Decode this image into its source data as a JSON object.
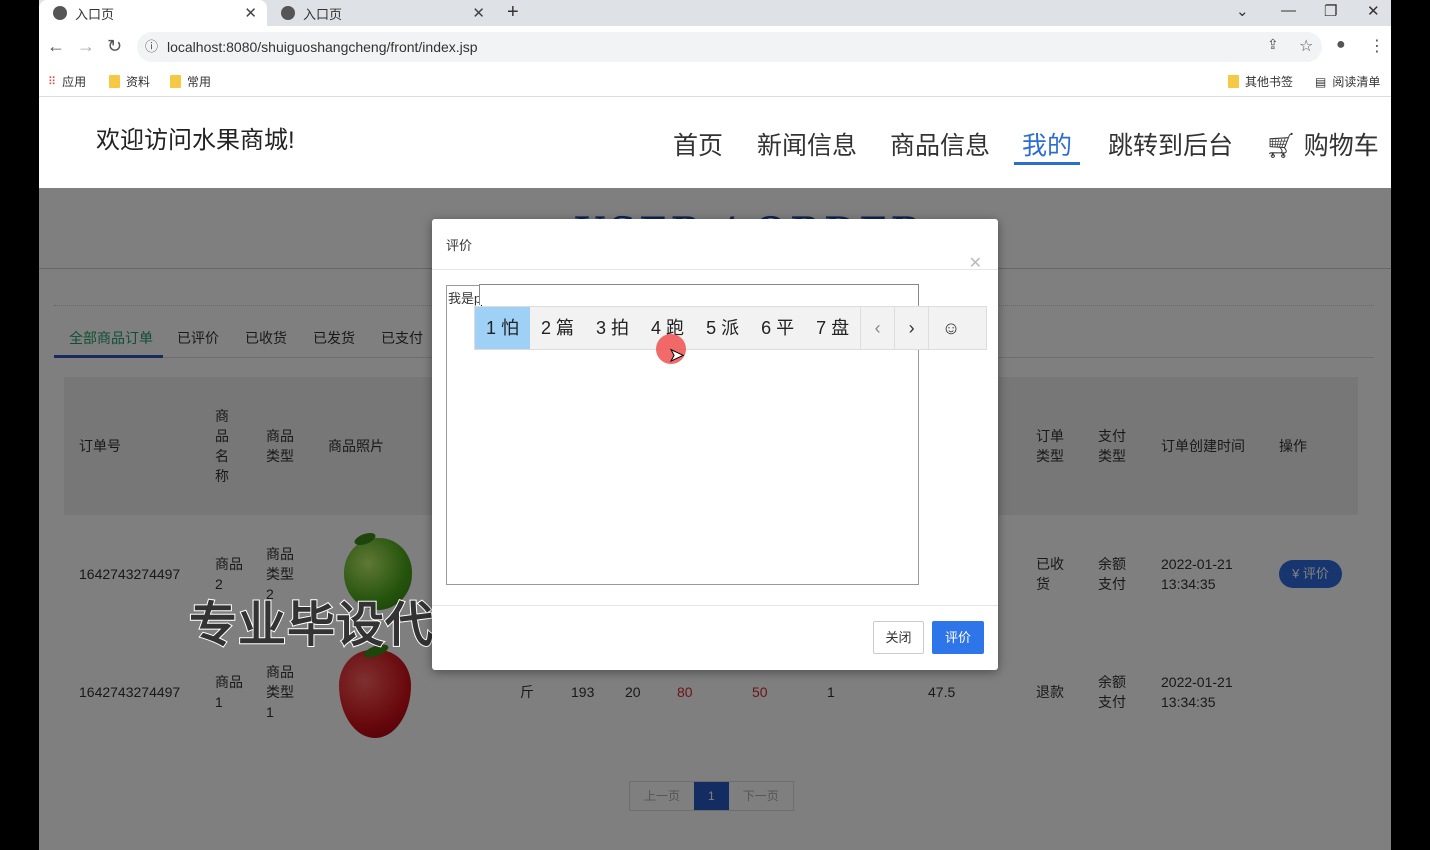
{
  "browser": {
    "tabs": [
      {
        "title": "入口页"
      },
      {
        "title": "入口页"
      }
    ],
    "url": "localhost:8080/shuiguoshangcheng/front/index.jsp",
    "bookmarks": [
      "应用",
      "资料",
      "常用"
    ],
    "bookmarks_right": [
      "其他书签",
      "阅读清单"
    ]
  },
  "header": {
    "welcome": "欢迎访问水果商城!",
    "nav": [
      "首页",
      "新闻信息",
      "商品信息",
      "我的",
      "跳转到后台",
      "购物车"
    ],
    "active": "我的"
  },
  "page": {
    "title": "USER / ORDER",
    "tabs": [
      "全部商品订单",
      "已评价",
      "已收货",
      "已发货",
      "已支付"
    ],
    "columns": [
      "订单号",
      "商品名称",
      "商品类型",
      "商品照片",
      "订单类型",
      "支付类型",
      "订单创建时间",
      "操作"
    ],
    "rows": [
      {
        "order_no": "1642743274497",
        "name": "商品2",
        "type": "商品类型2",
        "order_type": "已收货",
        "pay_type": "余额支付",
        "date": "2022-01-21",
        "time": "13:34:35",
        "action": "评价"
      },
      {
        "order_no": "1642743274497",
        "name": "商品1",
        "type": "商品类型1",
        "unit": "斤",
        "c1": "193",
        "c2": "20",
        "c3": "80",
        "c4": "50",
        "c5": "1",
        "c6": "47.5",
        "order_type": "退款",
        "pay_type": "余额支付",
        "date": "2022-01-21",
        "time": "13:34:35"
      }
    ],
    "pager": {
      "prev": "上一页",
      "current": "1",
      "next": "下一页"
    },
    "watermark": "专业毕设代做"
  },
  "modal": {
    "title": "评价",
    "text": "我是p",
    "close_label": "关闭",
    "submit_label": "评价",
    "ime_candidates": [
      "1 怕",
      "2 篇",
      "3 拍",
      "4 跑",
      "5 派",
      "6 平",
      "7 盘"
    ]
  },
  "colors": {
    "accent": "#2f75ea",
    "active_nav": "#2d6dd2"
  }
}
